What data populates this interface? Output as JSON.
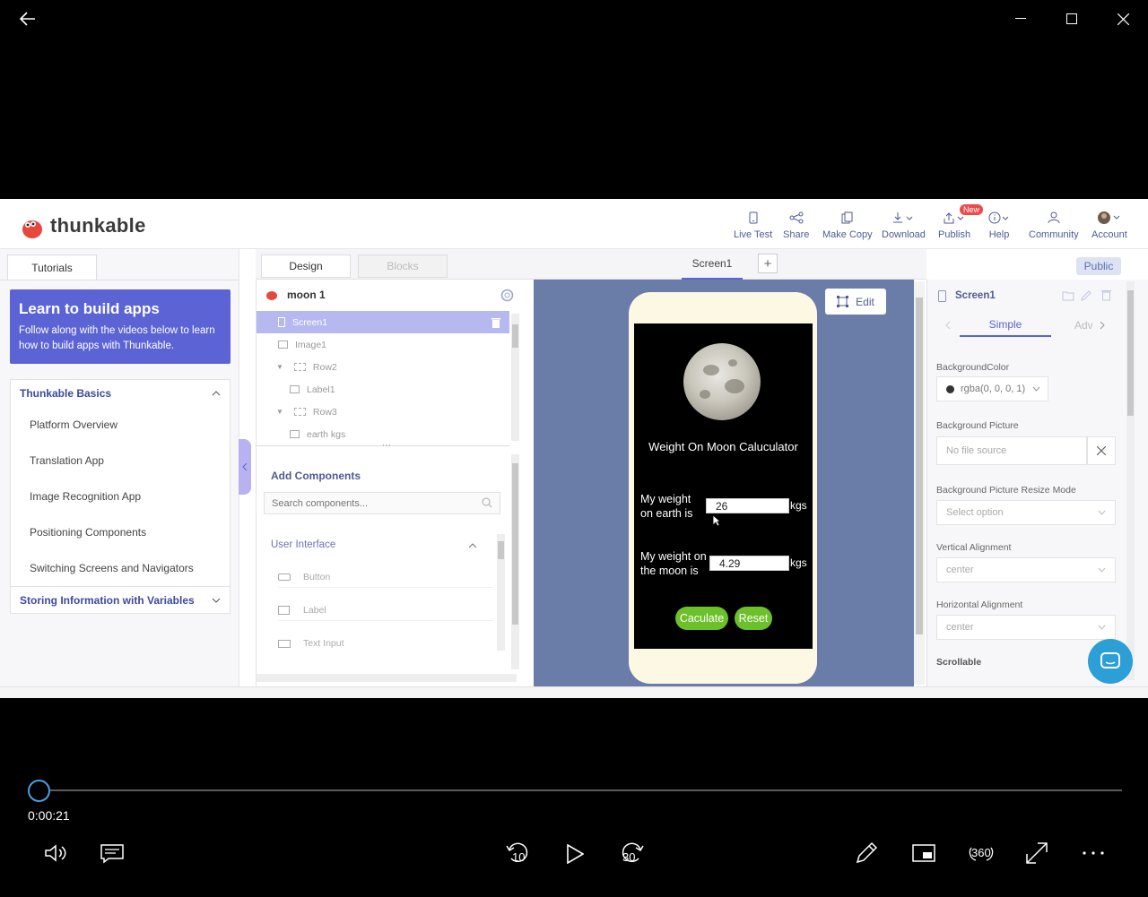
{
  "window": {
    "back_icon": "back-arrow-icon",
    "minimize_icon": "minimize-icon",
    "maximize_icon": "maximize-icon",
    "close_icon": "close-icon"
  },
  "thunkable": {
    "brand": "thunkable",
    "nav": [
      {
        "label": "Live Test",
        "icon": "phone-icon"
      },
      {
        "label": "Share",
        "icon": "share-icon"
      },
      {
        "label": "Make Copy",
        "icon": "copy-icon"
      },
      {
        "label": "Download",
        "icon": "download-icon"
      },
      {
        "label": "Publish",
        "icon": "publish-icon",
        "badge": "New"
      },
      {
        "label": "Help",
        "icon": "help-icon"
      },
      {
        "label": "Community",
        "icon": "community-icon"
      },
      {
        "label": "Account",
        "icon": "avatar-icon"
      }
    ],
    "tutorials": {
      "tab": "Tutorials",
      "banner_title": "Learn to build apps",
      "banner_sub": "Follow along with the videos below to learn how to build apps with Thunkable.",
      "section1": "Thunkable Basics",
      "items": [
        "Platform Overview",
        "Translation App",
        "Image Recognition App",
        "Positioning Components",
        "Switching Screens and Navigators"
      ],
      "section2": "Storing Information with Variables"
    },
    "tabs": {
      "design": "Design",
      "blocks": "Blocks",
      "screen": "Screen1",
      "add": "+",
      "public": "Public"
    },
    "project": {
      "name": "moon 1",
      "tree": [
        "Screen1",
        "Image1",
        "Row2",
        "Label1",
        "Row3",
        "earth kgs"
      ]
    },
    "components": {
      "title": "Add Components",
      "search_placeholder": "Search components...",
      "group": "User Interface",
      "items": [
        "Button",
        "Label",
        "Text Input"
      ]
    },
    "app_screen": {
      "title": "Weight  On Moon Caluculator",
      "earth_label": "My  weight on earth is",
      "earth_value": "26",
      "moon_label": "My weight on the moon is",
      "moon_value": "4.29",
      "unit": "kgs",
      "calc_button": "Caculate",
      "reset_button": "Reset",
      "edit_button": "Edit"
    },
    "properties": {
      "component": "Screen1",
      "tab_simple": "Simple",
      "tab_adv": "Adv",
      "bg_color_label": "BackgroundColor",
      "bg_color_value": "rgba(0, 0, 0, 1)",
      "bg_picture_label": "Background Picture",
      "bg_picture_value": "No file source",
      "resize_label": "Background Picture Resize Mode",
      "resize_value": "Select option",
      "valign_label": "Vertical Alignment",
      "valign_value": "center",
      "halign_label": "Horizontal Alignment",
      "halign_value": "center",
      "scroll_label": "Scrollable"
    }
  },
  "player": {
    "time": "0:00:21",
    "progress": 0,
    "skip_back": "10",
    "skip_forward": "30",
    "vr_label": "360"
  },
  "colors": {
    "accent": "#5b63d5",
    "canvas": "#6a7ca8",
    "green_button": "#6cc02a",
    "nav_text": "#4f5b93"
  }
}
